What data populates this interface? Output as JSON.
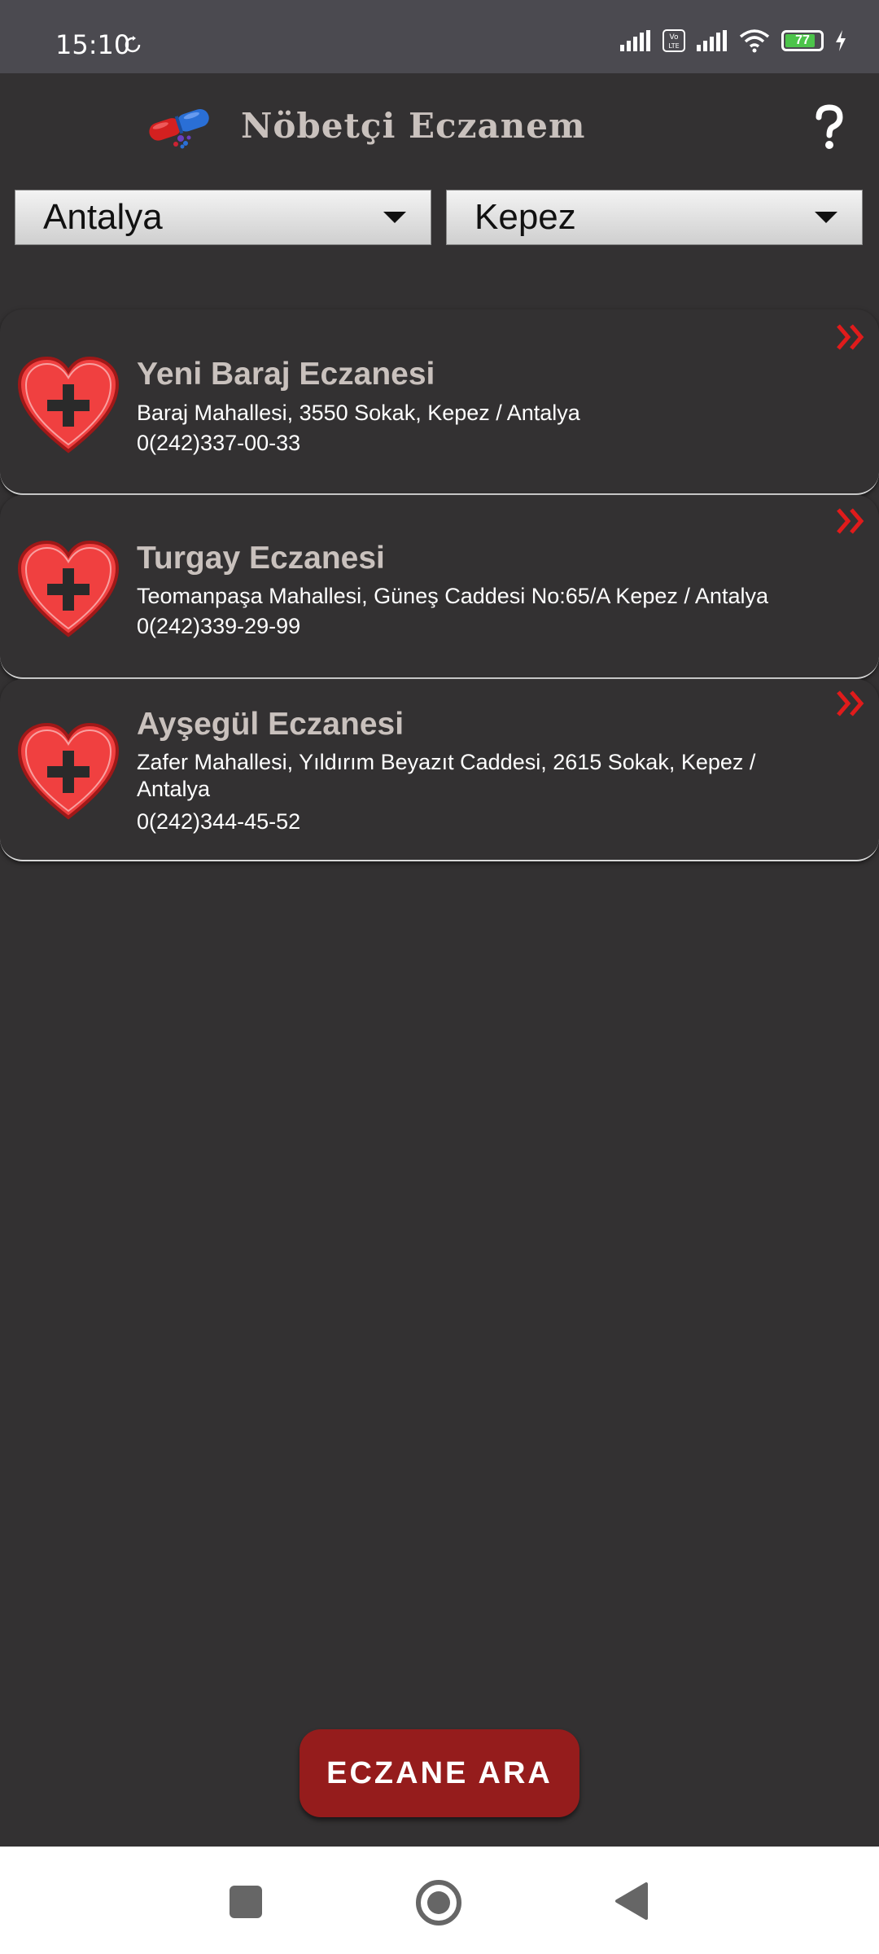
{
  "status_bar": {
    "time": "15:10",
    "battery_level": "77",
    "icons": [
      "sync-icon",
      "signal-icon",
      "volte-icon",
      "signal-icon",
      "wifi-icon",
      "battery-icon",
      "charging-icon"
    ]
  },
  "header": {
    "title": "Nöbetçi Eczanem"
  },
  "filters": {
    "city": "Antalya",
    "district": "Kepez"
  },
  "pharmacies": [
    {
      "name": "Yeni Baraj Eczanesi",
      "address": "Baraj Mahallesi, 3550 Sokak, Kepez / Antalya",
      "phone": "0(242)337-00-33"
    },
    {
      "name": "Turgay Eczanesi",
      "address": "Teomanpaşa Mahallesi, Güneş Caddesi No:65/A Kepez / Antalya",
      "phone": "0(242)339-29-99"
    },
    {
      "name": "Ayşegül Eczanesi",
      "address": "Zafer Mahallesi, Yıldırım Beyazıt Caddesi, 2615 Sokak, Kepez / Antalya",
      "phone": "0(242)344-45-52"
    }
  ],
  "search_button": {
    "label": "ECZANE ARA"
  },
  "colors": {
    "background": "#333132",
    "accent_red": "#951c1c",
    "heart_red": "#f04040",
    "title_color": "#c9c1bd"
  }
}
